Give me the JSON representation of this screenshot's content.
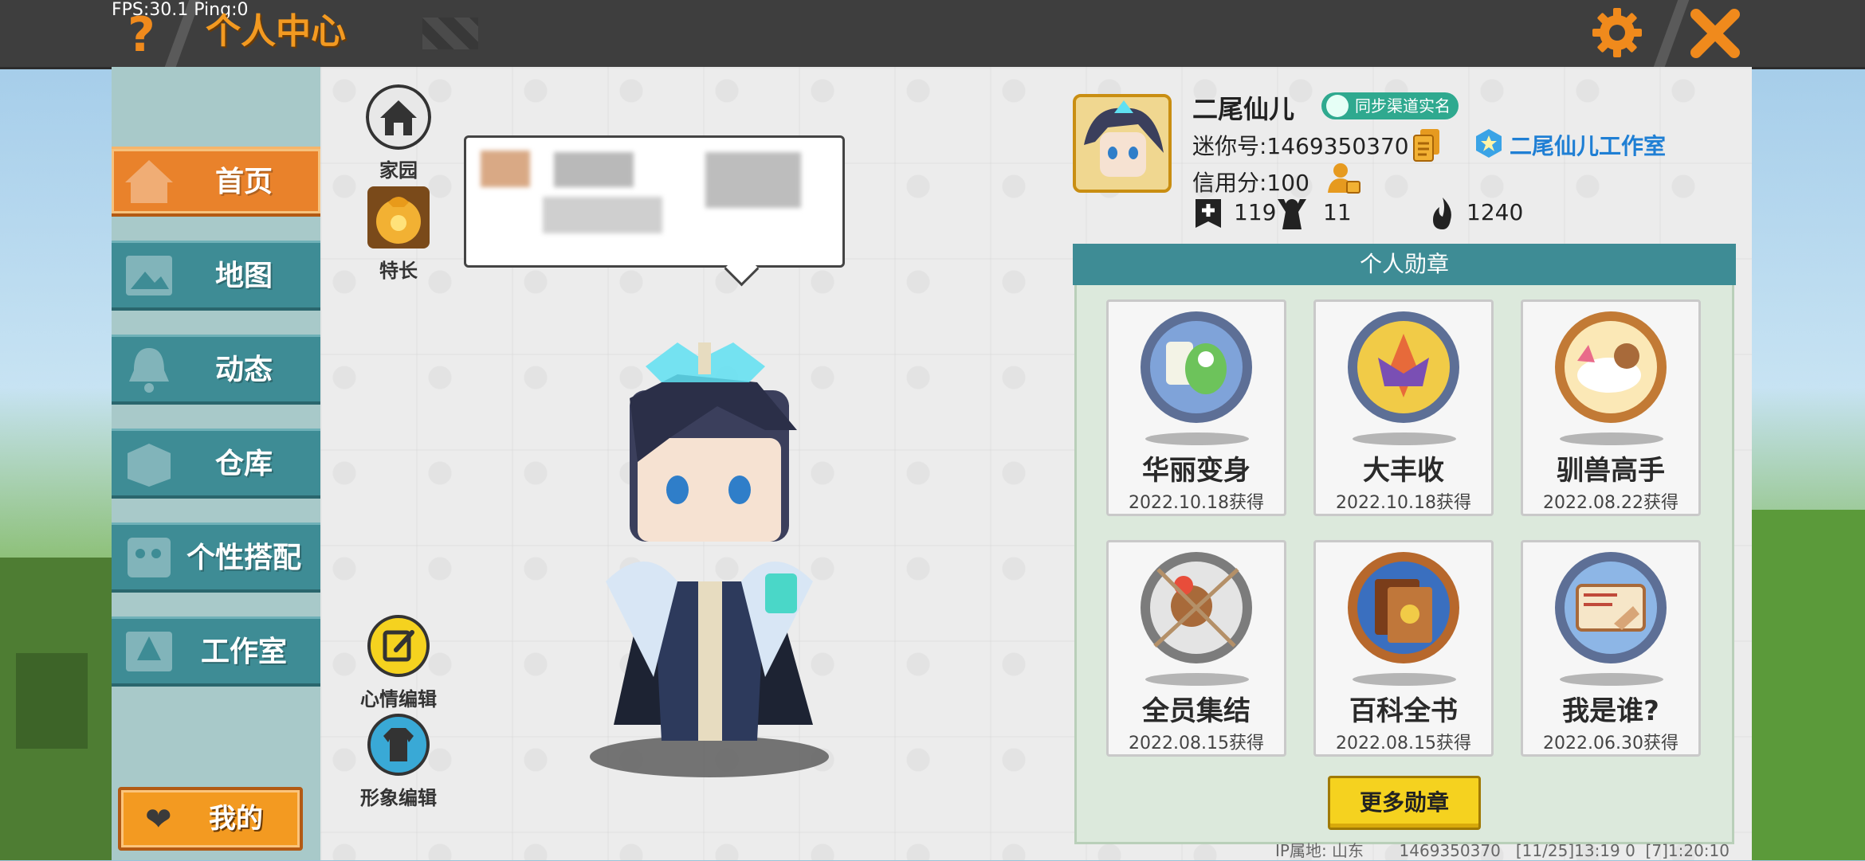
{
  "topbar": {
    "fps": "FPS:30.1  Ping:0",
    "help_icon": "?",
    "title": "个人中心",
    "gear_icon": "gear-icon",
    "close_icon": "close-icon"
  },
  "sidebar": {
    "items": [
      {
        "label": "首页",
        "icon": "house-icon",
        "active": true
      },
      {
        "label": "地图",
        "icon": "map-icon",
        "active": false
      },
      {
        "label": "动态",
        "icon": "bell-icon",
        "active": false
      },
      {
        "label": "仓库",
        "icon": "box-icon",
        "active": false
      },
      {
        "label": "个性搭配",
        "icon": "palette-icon",
        "active": false
      },
      {
        "label": "工作室",
        "icon": "tree-icon",
        "active": false
      }
    ],
    "mine_label": "我的"
  },
  "tools": {
    "home_label": "家园",
    "talent_label": "特长",
    "mood_label": "心情编辑",
    "appearance_label": "形象编辑"
  },
  "profile": {
    "name": "二尾仙儿",
    "verified_badge": "同步渠道实名",
    "mini_id": "迷你号:1469350370",
    "studio": "二尾仙儿工作室",
    "credit": "信用分:100",
    "stats": {
      "adds": "119",
      "fans": "11",
      "heat": "1240"
    }
  },
  "medals": {
    "title": "个人勋章",
    "items": [
      {
        "name": "华丽变身",
        "date": "2022.10.18获得",
        "color": "#4a6fb0"
      },
      {
        "name": "大丰收",
        "date": "2022.10.18获得",
        "color": "#4a6fb0"
      },
      {
        "name": "驯兽高手",
        "date": "2022.08.22获得",
        "color": "#d58a42"
      },
      {
        "name": "全员集结",
        "date": "2022.08.15获得",
        "color": "#8a8a8a"
      },
      {
        "name": "百科全书",
        "date": "2022.08.15获得",
        "color": "#c0773a"
      },
      {
        "name": "我是谁?",
        "date": "2022.06.30获得",
        "color": "#4a6fb0"
      }
    ],
    "more_label": "更多勋章"
  },
  "footer": {
    "text": "IP属地: 山东       1469350370   [11/25]13:19 0  [7]1:20:10"
  },
  "colors": {
    "accent_orange": "#e9822b",
    "teal": "#3e8c95",
    "yellow_button": "#f5d21f"
  }
}
